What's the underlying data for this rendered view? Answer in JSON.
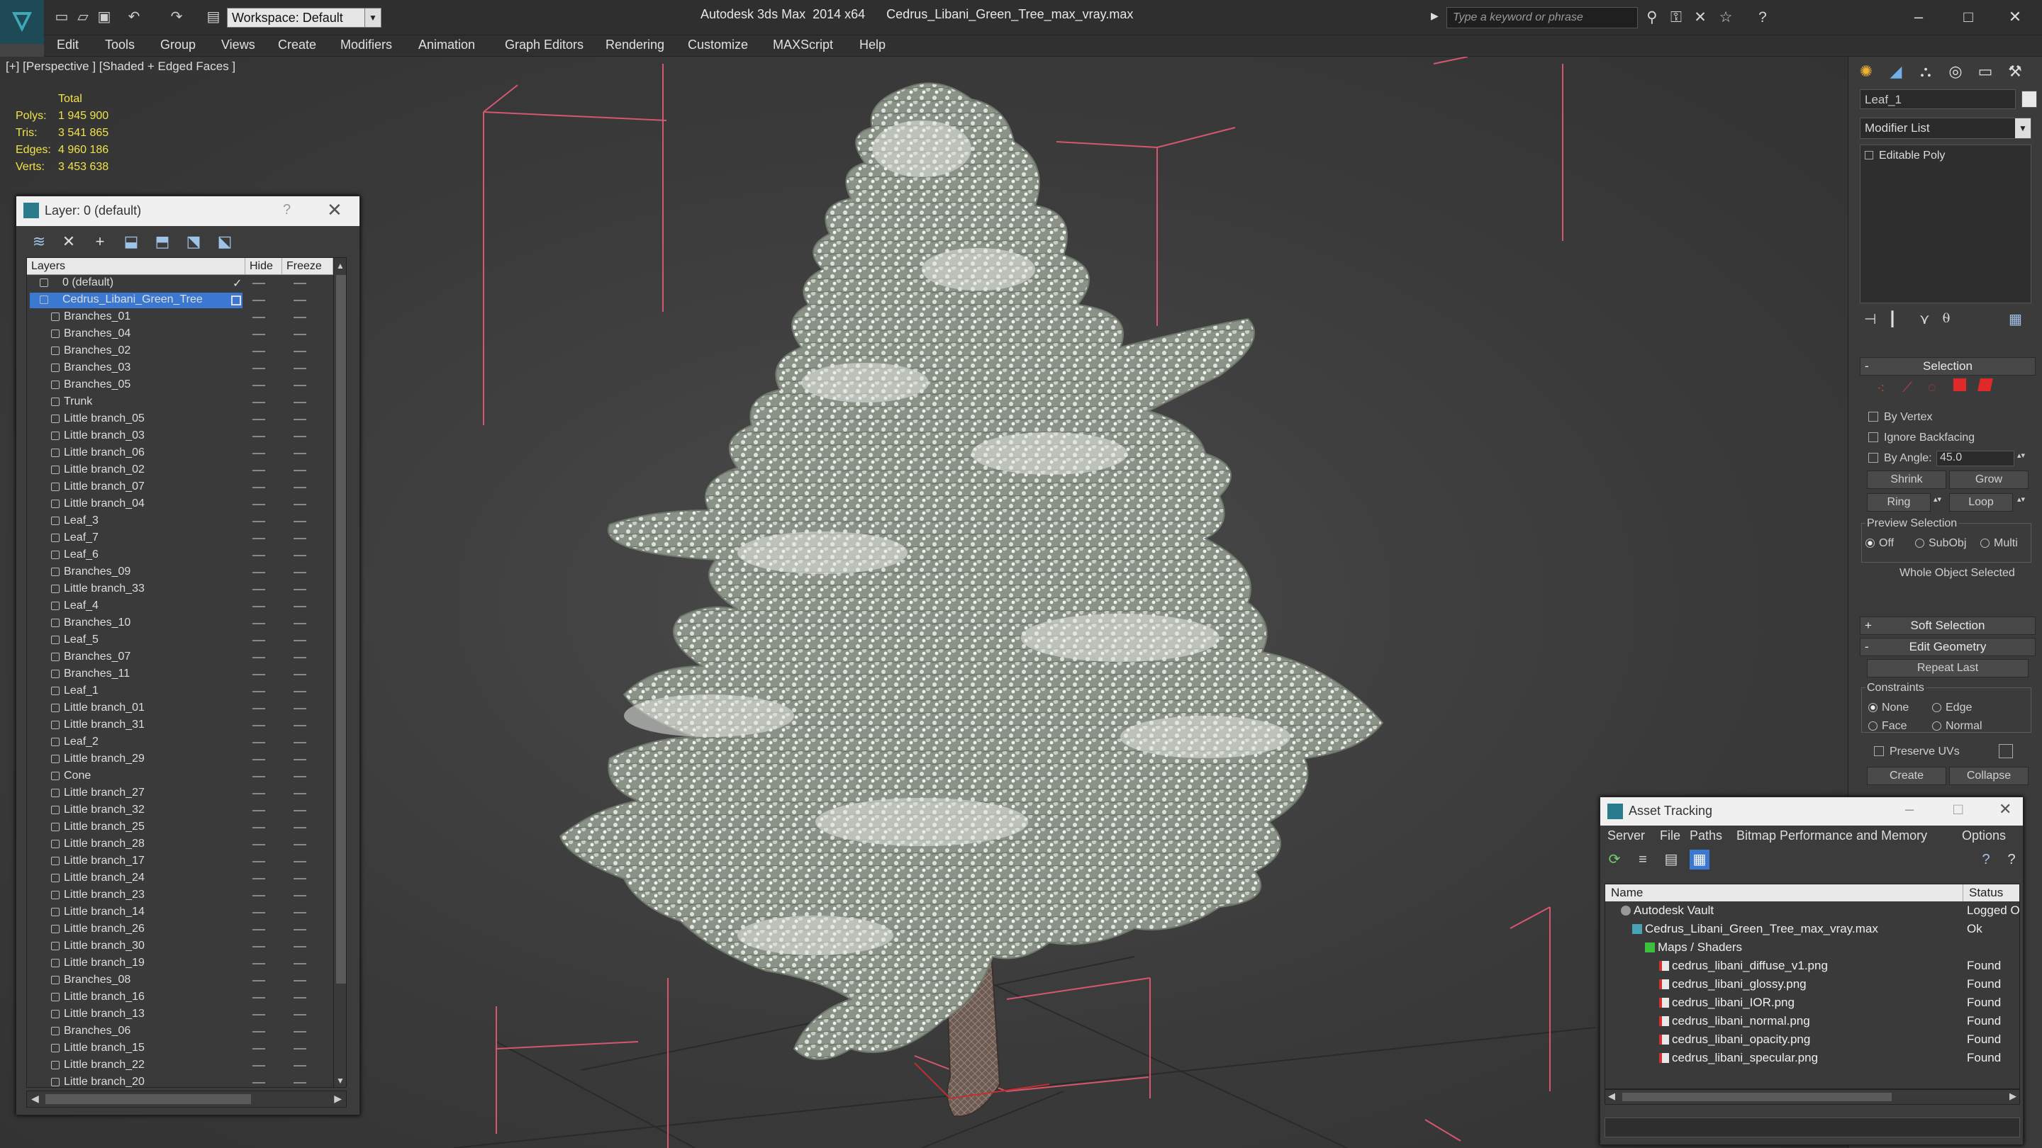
{
  "titlebar": {
    "title_app": "Autodesk 3ds Max  2014 x64",
    "title_file": "Cedrus_Libani_Green_Tree_max_vray.max",
    "workspace": "Workspace: Default",
    "search_placeholder": "Type a keyword or phrase"
  },
  "menu": [
    "Edit",
    "Tools",
    "Group",
    "Views",
    "Create",
    "Modifiers",
    "Animation",
    "Graph Editors",
    "Rendering",
    "Customize",
    "MAXScript",
    "Help"
  ],
  "viewport": {
    "label": "[+] [Perspective ] [Shaded + Edged Faces ]",
    "stats": {
      "header": "Total",
      "rows": [
        {
          "k": "Polys:",
          "v": "1 945 900"
        },
        {
          "k": "Tris:",
          "v": "3 541 865"
        },
        {
          "k": "Edges:",
          "v": "4 960 186"
        },
        {
          "k": "Verts:",
          "v": "3 453 638"
        }
      ]
    }
  },
  "layer_dialog": {
    "title": "Layer: 0 (default)",
    "help": "?",
    "columns": {
      "layers": "Layers",
      "hide": "Hide",
      "freeze": "Freeze"
    },
    "rows": [
      {
        "name": "0 (default)",
        "type": "layer"
      },
      {
        "name": "Cedrus_Libani_Green_Tree",
        "type": "layer-selected"
      },
      {
        "name": "Branches_01"
      },
      {
        "name": "Branches_04"
      },
      {
        "name": "Branches_02"
      },
      {
        "name": "Branches_03"
      },
      {
        "name": "Branches_05"
      },
      {
        "name": "Trunk"
      },
      {
        "name": "Little branch_05"
      },
      {
        "name": "Little branch_03"
      },
      {
        "name": "Little branch_06"
      },
      {
        "name": "Little branch_02"
      },
      {
        "name": "Little branch_07"
      },
      {
        "name": "Little branch_04"
      },
      {
        "name": "Leaf_3"
      },
      {
        "name": "Leaf_7"
      },
      {
        "name": "Leaf_6"
      },
      {
        "name": "Branches_09"
      },
      {
        "name": "Little branch_33"
      },
      {
        "name": "Leaf_4"
      },
      {
        "name": "Branches_10"
      },
      {
        "name": "Leaf_5"
      },
      {
        "name": "Branches_07"
      },
      {
        "name": "Branches_11"
      },
      {
        "name": "Leaf_1"
      },
      {
        "name": "Little branch_01"
      },
      {
        "name": "Little branch_31"
      },
      {
        "name": "Leaf_2"
      },
      {
        "name": "Little branch_29"
      },
      {
        "name": "Cone"
      },
      {
        "name": "Little branch_27"
      },
      {
        "name": "Little branch_32"
      },
      {
        "name": "Little branch_25"
      },
      {
        "name": "Little branch_28"
      },
      {
        "name": "Little branch_17"
      },
      {
        "name": "Little branch_24"
      },
      {
        "name": "Little branch_23"
      },
      {
        "name": "Little branch_14"
      },
      {
        "name": "Little branch_26"
      },
      {
        "name": "Little branch_30"
      },
      {
        "name": "Little branch_19"
      },
      {
        "name": "Branches_08"
      },
      {
        "name": "Little branch_16"
      },
      {
        "name": "Little branch_13"
      },
      {
        "name": "Branches_06"
      },
      {
        "name": "Little branch_15"
      },
      {
        "name": "Little branch_22"
      },
      {
        "name": "Little branch_20"
      }
    ]
  },
  "command_panel": {
    "object_name": "Leaf_1",
    "modifier_list": "Modifier List",
    "stack_item": "Editable Poly",
    "selection": {
      "header": "Selection",
      "by_vertex": "By Vertex",
      "ignore_backfacing": "Ignore Backfacing",
      "by_angle": "By Angle:",
      "angle_value": "45.0",
      "shrink": "Shrink",
      "grow": "Grow",
      "ring": "Ring",
      "loop": "Loop",
      "preview_selection": "Preview Selection",
      "off": "Off",
      "subobj": "SubObj",
      "multi": "Multi",
      "status": "Whole Object Selected"
    },
    "soft_selection": "Soft Selection",
    "edit_geometry": {
      "header": "Edit Geometry",
      "repeat_last": "Repeat Last",
      "constraints": "Constraints",
      "none": "None",
      "edge": "Edge",
      "face": "Face",
      "normal": "Normal",
      "preserve_uvs": "Preserve UVs",
      "create": "Create",
      "collapse": "Collapse"
    }
  },
  "asset_tracking": {
    "title": "Asset Tracking",
    "menu": [
      "Server",
      "File",
      "Paths",
      "Bitmap Performance and Memory",
      "Options"
    ],
    "columns": {
      "name": "Name",
      "status": "Status"
    },
    "rows": [
      {
        "name": "Autodesk Vault",
        "status": "Logged Ou"
      },
      {
        "name": "Cedrus_Libani_Green_Tree_max_vray.max",
        "status": "Ok"
      },
      {
        "name": "Maps / Shaders",
        "status": ""
      },
      {
        "name": "cedrus_libani_diffuse_v1.png",
        "status": "Found"
      },
      {
        "name": "cedrus_libani_glossy.png",
        "status": "Found"
      },
      {
        "name": "cedrus_libani_IOR.png",
        "status": "Found"
      },
      {
        "name": "cedrus_libani_normal.png",
        "status": "Found"
      },
      {
        "name": "cedrus_libani_opacity.png",
        "status": "Found"
      },
      {
        "name": "cedrus_libani_specular.png",
        "status": "Found"
      }
    ]
  },
  "colors": {
    "stats_text": "#f0e24a",
    "selection_blue": "#3b78d1",
    "bbox_pink": "#d4576f"
  }
}
